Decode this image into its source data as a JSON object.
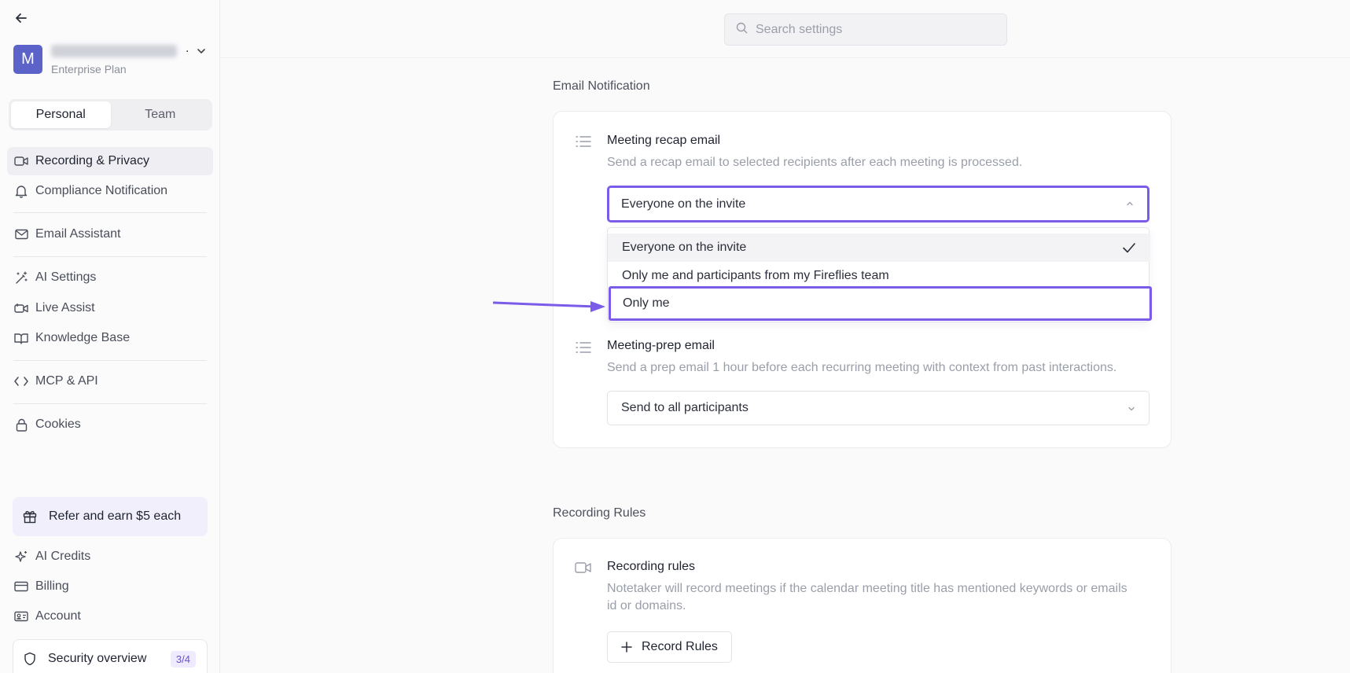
{
  "sidebar": {
    "back_icon": "arrow-left-icon",
    "account": {
      "avatar_letter": "M",
      "email_obscured": "",
      "plan": "Enterprise Plan"
    },
    "segment": {
      "personal": "Personal",
      "team": "Team",
      "active": "Personal"
    },
    "nav": [
      {
        "label": "Recording & Privacy",
        "icon": "video-camera-icon",
        "active": true
      },
      {
        "label": "Compliance Notification",
        "icon": "bell-icon"
      },
      {
        "label": "Email Assistant",
        "icon": "mail-icon"
      },
      {
        "label": "AI Settings",
        "icon": "magic-wand-icon"
      },
      {
        "label": "Live Assist",
        "icon": "video-plus-icon"
      },
      {
        "label": "Knowledge Base",
        "icon": "book-open-icon"
      },
      {
        "label": "MCP & API",
        "icon": "code-icon"
      },
      {
        "label": "Cookies",
        "icon": "lock-icon"
      }
    ],
    "refer": {
      "label": "Refer and earn $5 each",
      "icon": "gift-icon"
    },
    "bottom_nav": [
      {
        "label": "AI Credits",
        "icon": "sparkles-icon"
      },
      {
        "label": "Billing",
        "icon": "credit-card-icon"
      },
      {
        "label": "Account",
        "icon": "id-card-icon"
      }
    ],
    "security": {
      "label": "Security overview",
      "badge": "3/4",
      "icon": "shield-icon"
    }
  },
  "search": {
    "placeholder": "Search settings",
    "value": ""
  },
  "email_notification": {
    "section_title": "Email Notification",
    "recap": {
      "title": "Meeting recap email",
      "description": "Send a recap email to selected recipients after each meeting is processed.",
      "selected": "Everyone on the invite",
      "options": [
        "Everyone on the invite",
        "Only me and participants from my Fireflies team",
        "Only me"
      ]
    },
    "prep": {
      "title": "Meeting-prep email",
      "description": "Send a prep email 1 hour before each recurring meeting with context from past interactions.",
      "selected": "Send to all participants"
    }
  },
  "recording_rules": {
    "section_title": "Recording Rules",
    "title": "Recording rules",
    "description_line1": "Notetaker will record meetings if the calendar meeting title has mentioned keywords or emails",
    "description_line2": "id or domains.",
    "button": "Record Rules"
  },
  "colors": {
    "accent": "#7b5ce8",
    "avatar": "#5b63c8"
  }
}
